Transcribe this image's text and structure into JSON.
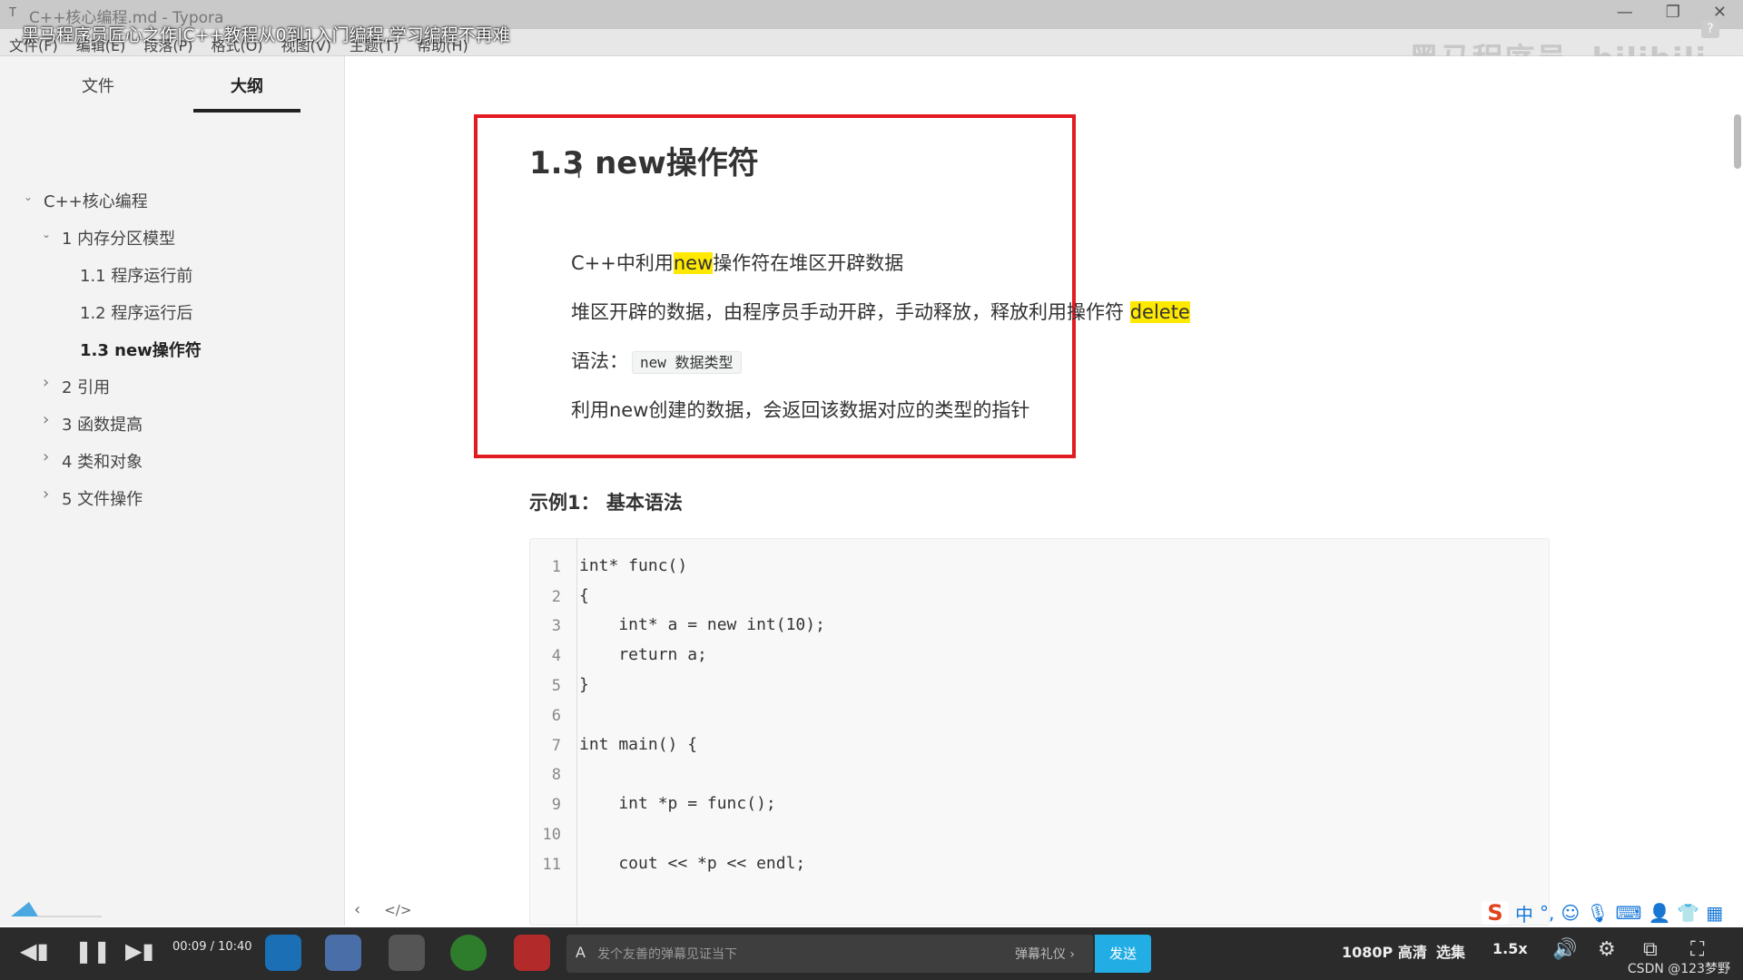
{
  "window": {
    "title": "C++核心编程.md - Typora",
    "app_icon": "T",
    "video_title": "黑马程序员匠心之作|C++教程从0到1入门编程,学习编程不再难",
    "watermark": "黑马程序员· bilibili",
    "controls": [
      "—",
      "❐",
      "✕"
    ],
    "help_glyph": "?"
  },
  "menu": [
    "文件(F)",
    "编辑(E)",
    "段落(P)",
    "格式(O)",
    "视图(V)",
    "主题(T)",
    "帮助(H)"
  ],
  "sidebar": {
    "tabs": [
      "文件",
      "大纲"
    ],
    "active_tab": "大纲",
    "outline": [
      {
        "label": "C++核心编程",
        "level": 0,
        "chevron": "⌄",
        "active": false
      },
      {
        "label": "1 内存分区模型",
        "level": 1,
        "chevron": "⌄",
        "active": false
      },
      {
        "label": "1.1 程序运行前",
        "level": 2,
        "chevron": "",
        "active": false
      },
      {
        "label": "1.2 程序运行后",
        "level": 2,
        "chevron": "",
        "active": false
      },
      {
        "label": "1.3 new操作符",
        "level": 2,
        "chevron": "",
        "active": true
      },
      {
        "label": "2 引用",
        "level": 1,
        "chevron": "›",
        "active": false
      },
      {
        "label": "3 函数提高",
        "level": 1,
        "chevron": "›",
        "active": false
      },
      {
        "label": "4 类和对象",
        "level": 1,
        "chevron": "›",
        "active": false
      },
      {
        "label": "5 文件操作",
        "level": 1,
        "chevron": "›",
        "active": false
      }
    ]
  },
  "doc": {
    "heading": "1.3 new操作符",
    "p1": {
      "pre": "C++中利用",
      "hl": "new",
      "post": "操作符在堆区开辟数据"
    },
    "p2": {
      "pre": "堆区开辟的数据，由程序员手动开辟，手动释放，释放利用操作符 ",
      "hl": "delete"
    },
    "p3": {
      "pre": "语法：",
      "code": "new 数据类型"
    },
    "p4": "利用new创建的数据，会返回该数据对应的类型的指针",
    "example_title": "示例1： 基本语法",
    "code_lines": [
      "int* func()",
      "{",
      "    int* a = new int(10);",
      "    return a;",
      "}",
      "",
      "int main() {",
      "",
      "    int *p = func();",
      "",
      "    cout << *p << endl;"
    ],
    "code_line_numbers": [
      "1",
      "2",
      "3",
      "4",
      "5",
      "6",
      "7",
      "8",
      "9",
      "10",
      "11"
    ]
  },
  "docbar": {
    "prev_glyph": "‹",
    "source_glyph": "</>"
  },
  "player": {
    "time": "00:09 / 10:40",
    "danmaku_placeholder": "发个友善的弹幕见证当下",
    "danmaku_gift": "弹幕礼仪 ›",
    "send": "发送",
    "quality": "1080P 高清",
    "episodes": "选集",
    "speed": "1.5x",
    "ime_lang": "中",
    "csdn_watermark": "CSDN @123梦野"
  },
  "colors": {
    "highlight": "#ffe900",
    "redbox": "#e21b23",
    "send": "#23ade5"
  }
}
